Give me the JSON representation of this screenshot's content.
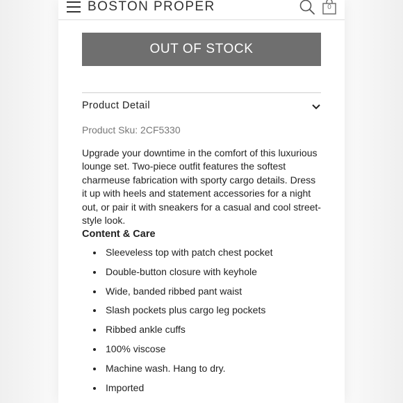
{
  "header": {
    "brand": "BOSTON PROPER",
    "cart_count": "0",
    "icons": [
      "hamburger-menu-icon",
      "search-icon",
      "shopping-bag-icon"
    ]
  },
  "product": {
    "stock_button_label": "OUT OF STOCK",
    "detail_section_title": "Product Detail",
    "sku": "Product Sku: 2CF5330",
    "description": "Upgrade your downtime in the comfort of this luxurious lounge set. Two-piece outfit features the softest charmeuse fabrication with sporty cargo details. Dress it up with heels and statement accessories for a night out, or pair it with sneakers for a casual and cool street-style look.",
    "care_title": "Content & Care",
    "care_items": [
      "Sleeveless top with patch chest pocket",
      "Double-button closure with keyhole",
      "Wide, banded ribbed pant waist",
      "Slash pockets plus cargo leg pockets",
      "Ribbed ankle cuffs",
      "100% viscose",
      "Machine wash. Hang to dry.",
      "Imported"
    ]
  },
  "colors": {
    "button_bg": "#6f6f6f",
    "text": "#222222",
    "muted_text": "#777777"
  }
}
